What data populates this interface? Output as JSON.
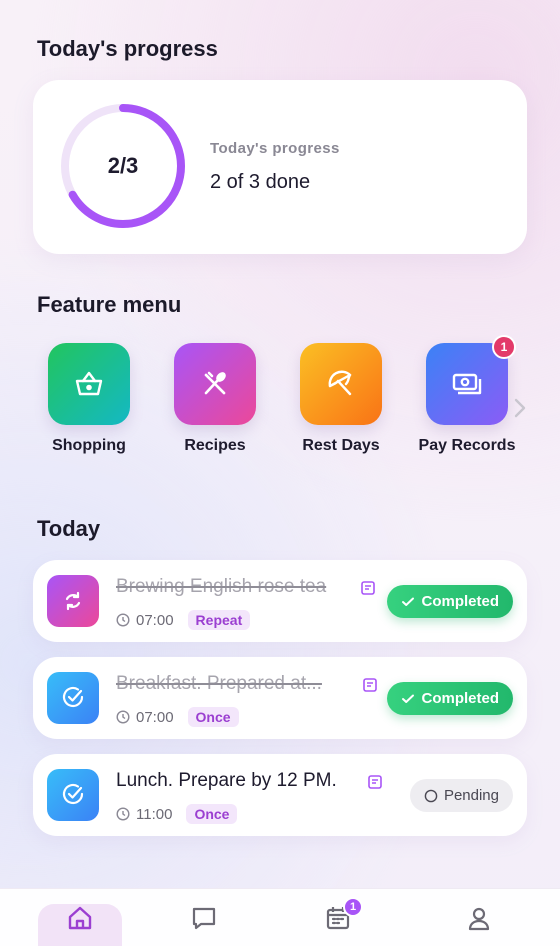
{
  "progress": {
    "section_title": "Today's progress",
    "ring_text": "2/3",
    "label": "Today's progress",
    "value_text": "2 of 3 done",
    "done": 2,
    "total": 3,
    "ring_color": "#a855f7"
  },
  "features": {
    "section_title": "Feature menu",
    "items": [
      {
        "label": "Shopping",
        "icon": "basket-icon",
        "colors": [
          "#22c55e",
          "#14b8c4"
        ]
      },
      {
        "label": "Recipes",
        "icon": "fork-spoon-icon",
        "colors": [
          "#a855f7",
          "#ec4899"
        ]
      },
      {
        "label": "Rest Days",
        "icon": "umbrella-icon",
        "colors": [
          "#fbbf24",
          "#f97316"
        ]
      },
      {
        "label": "Pay Records",
        "icon": "money-icon",
        "colors": [
          "#3b82f6",
          "#8b5cf6"
        ],
        "badge": "1"
      }
    ],
    "more_icon": "chevron-right-icon"
  },
  "today": {
    "section_title": "Today",
    "tasks": [
      {
        "title": "Brewing English rose tea",
        "time": "07:00",
        "tag": "Repeat",
        "status": "Completed",
        "done": true,
        "icon": "repeat-icon"
      },
      {
        "title": "Breakfast. Prepared at...",
        "time": "07:00",
        "tag": "Once",
        "status": "Completed",
        "done": true,
        "icon": "check-circle-icon"
      },
      {
        "title": "Lunch. Prepare by 12 PM.",
        "time": "11:00",
        "tag": "Once",
        "status": "Pending",
        "done": false,
        "icon": "check-circle-icon"
      }
    ]
  },
  "nav": {
    "items": [
      {
        "icon": "home-icon",
        "active": true
      },
      {
        "icon": "chat-icon",
        "active": false
      },
      {
        "icon": "calendar-icon",
        "active": false,
        "badge": "1"
      },
      {
        "icon": "profile-icon",
        "active": false
      }
    ]
  }
}
